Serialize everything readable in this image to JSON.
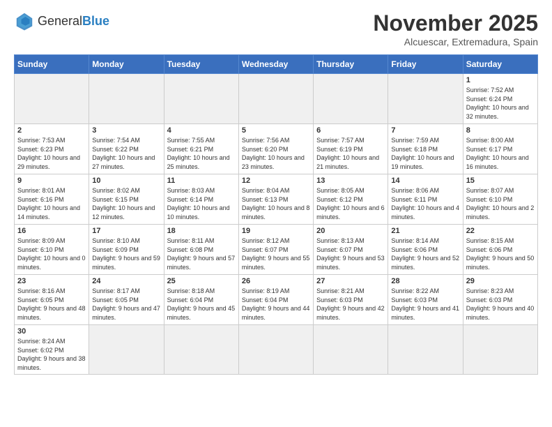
{
  "header": {
    "logo_general": "General",
    "logo_blue": "Blue",
    "month_title": "November 2025",
    "subtitle": "Alcuescar, Extremadura, Spain"
  },
  "weekdays": [
    "Sunday",
    "Monday",
    "Tuesday",
    "Wednesday",
    "Thursday",
    "Friday",
    "Saturday"
  ],
  "weeks": [
    [
      {
        "day": "",
        "empty": true
      },
      {
        "day": "",
        "empty": true
      },
      {
        "day": "",
        "empty": true
      },
      {
        "day": "",
        "empty": true
      },
      {
        "day": "",
        "empty": true
      },
      {
        "day": "",
        "empty": true
      },
      {
        "day": "1",
        "sunrise": "7:52 AM",
        "sunset": "6:24 PM",
        "daylight": "10 hours and 32 minutes."
      }
    ],
    [
      {
        "day": "2",
        "sunrise": "7:53 AM",
        "sunset": "6:23 PM",
        "daylight": "10 hours and 29 minutes."
      },
      {
        "day": "3",
        "sunrise": "7:54 AM",
        "sunset": "6:22 PM",
        "daylight": "10 hours and 27 minutes."
      },
      {
        "day": "4",
        "sunrise": "7:55 AM",
        "sunset": "6:21 PM",
        "daylight": "10 hours and 25 minutes."
      },
      {
        "day": "5",
        "sunrise": "7:56 AM",
        "sunset": "6:20 PM",
        "daylight": "10 hours and 23 minutes."
      },
      {
        "day": "6",
        "sunrise": "7:57 AM",
        "sunset": "6:19 PM",
        "daylight": "10 hours and 21 minutes."
      },
      {
        "day": "7",
        "sunrise": "7:59 AM",
        "sunset": "6:18 PM",
        "daylight": "10 hours and 19 minutes."
      },
      {
        "day": "8",
        "sunrise": "8:00 AM",
        "sunset": "6:17 PM",
        "daylight": "10 hours and 16 minutes."
      }
    ],
    [
      {
        "day": "9",
        "sunrise": "8:01 AM",
        "sunset": "6:16 PM",
        "daylight": "10 hours and 14 minutes."
      },
      {
        "day": "10",
        "sunrise": "8:02 AM",
        "sunset": "6:15 PM",
        "daylight": "10 hours and 12 minutes."
      },
      {
        "day": "11",
        "sunrise": "8:03 AM",
        "sunset": "6:14 PM",
        "daylight": "10 hours and 10 minutes."
      },
      {
        "day": "12",
        "sunrise": "8:04 AM",
        "sunset": "6:13 PM",
        "daylight": "10 hours and 8 minutes."
      },
      {
        "day": "13",
        "sunrise": "8:05 AM",
        "sunset": "6:12 PM",
        "daylight": "10 hours and 6 minutes."
      },
      {
        "day": "14",
        "sunrise": "8:06 AM",
        "sunset": "6:11 PM",
        "daylight": "10 hours and 4 minutes."
      },
      {
        "day": "15",
        "sunrise": "8:07 AM",
        "sunset": "6:10 PM",
        "daylight": "10 hours and 2 minutes."
      }
    ],
    [
      {
        "day": "16",
        "sunrise": "8:09 AM",
        "sunset": "6:10 PM",
        "daylight": "10 hours and 0 minutes."
      },
      {
        "day": "17",
        "sunrise": "8:10 AM",
        "sunset": "6:09 PM",
        "daylight": "9 hours and 59 minutes."
      },
      {
        "day": "18",
        "sunrise": "8:11 AM",
        "sunset": "6:08 PM",
        "daylight": "9 hours and 57 minutes."
      },
      {
        "day": "19",
        "sunrise": "8:12 AM",
        "sunset": "6:07 PM",
        "daylight": "9 hours and 55 minutes."
      },
      {
        "day": "20",
        "sunrise": "8:13 AM",
        "sunset": "6:07 PM",
        "daylight": "9 hours and 53 minutes."
      },
      {
        "day": "21",
        "sunrise": "8:14 AM",
        "sunset": "6:06 PM",
        "daylight": "9 hours and 52 minutes."
      },
      {
        "day": "22",
        "sunrise": "8:15 AM",
        "sunset": "6:06 PM",
        "daylight": "9 hours and 50 minutes."
      }
    ],
    [
      {
        "day": "23",
        "sunrise": "8:16 AM",
        "sunset": "6:05 PM",
        "daylight": "9 hours and 48 minutes."
      },
      {
        "day": "24",
        "sunrise": "8:17 AM",
        "sunset": "6:05 PM",
        "daylight": "9 hours and 47 minutes."
      },
      {
        "day": "25",
        "sunrise": "8:18 AM",
        "sunset": "6:04 PM",
        "daylight": "9 hours and 45 minutes."
      },
      {
        "day": "26",
        "sunrise": "8:19 AM",
        "sunset": "6:04 PM",
        "daylight": "9 hours and 44 minutes."
      },
      {
        "day": "27",
        "sunrise": "8:21 AM",
        "sunset": "6:03 PM",
        "daylight": "9 hours and 42 minutes."
      },
      {
        "day": "28",
        "sunrise": "8:22 AM",
        "sunset": "6:03 PM",
        "daylight": "9 hours and 41 minutes."
      },
      {
        "day": "29",
        "sunrise": "8:23 AM",
        "sunset": "6:03 PM",
        "daylight": "9 hours and 40 minutes."
      }
    ],
    [
      {
        "day": "30",
        "sunrise": "8:24 AM",
        "sunset": "6:02 PM",
        "daylight": "9 hours and 38 minutes."
      },
      {
        "day": "",
        "empty": true
      },
      {
        "day": "",
        "empty": true
      },
      {
        "day": "",
        "empty": true
      },
      {
        "day": "",
        "empty": true
      },
      {
        "day": "",
        "empty": true
      },
      {
        "day": "",
        "empty": true
      }
    ]
  ]
}
